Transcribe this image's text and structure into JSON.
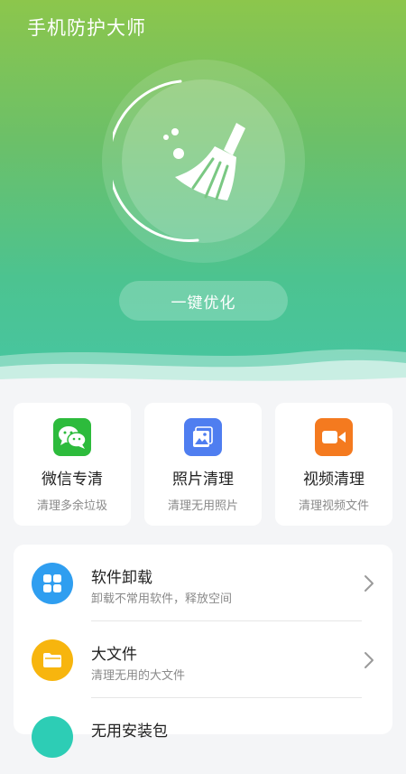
{
  "header": {
    "title": "手机防护大师"
  },
  "hero": {
    "optimize_label": "一键优化",
    "broom_icon": "broom-icon",
    "gradient_colors": [
      "#8cc64c",
      "#46c6a4"
    ]
  },
  "cards": [
    {
      "title": "微信专清",
      "subtitle": "清理多余垃圾",
      "icon": "wechat-icon",
      "color": "#2dbb3c"
    },
    {
      "title": "照片清理",
      "subtitle": "清理无用照片",
      "icon": "photo-icon",
      "color": "#4f7ef0"
    },
    {
      "title": "视频清理",
      "subtitle": "清理视频文件",
      "icon": "video-icon",
      "color": "#f47a1f"
    }
  ],
  "list": [
    {
      "title": "软件卸载",
      "subtitle": "卸载不常用软件，释放空间",
      "icon": "apps-grid-icon",
      "color": "#2f9ef0"
    },
    {
      "title": "大文件",
      "subtitle": "清理无用的大文件",
      "icon": "folder-icon",
      "color": "#f7b50e"
    },
    {
      "title": "无用安装包",
      "subtitle": "",
      "icon": "package-icon",
      "color": "#2dcdb5"
    }
  ]
}
